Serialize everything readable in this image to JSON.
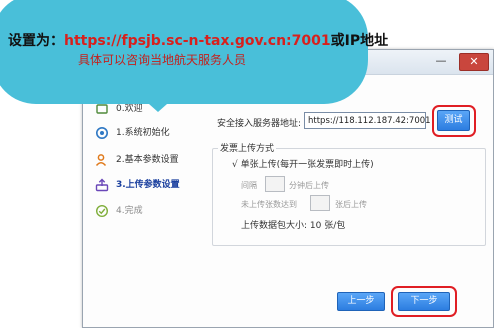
{
  "callout": {
    "prefix": "设置为：",
    "url": "https://fpsjb.sc-n-tax.gov.cn:7001",
    "suffix": "或IP地址",
    "line2": "具体可以咨询当地航天服务人员"
  },
  "window": {
    "minimize_glyph": "—",
    "close_glyph": "✕"
  },
  "steps": [
    {
      "label": "0.欢迎",
      "icon": "welcome-icon"
    },
    {
      "label": "1.系统初始化",
      "icon": "gear-icon"
    },
    {
      "label": "2.基本参数设置",
      "icon": "user-settings-icon"
    },
    {
      "label": "3.上传参数设置",
      "icon": "upload-icon"
    },
    {
      "label": "4.完成",
      "icon": "check-circle-icon"
    }
  ],
  "server": {
    "label": "安全接入服务器地址:",
    "value": "https://118.112.187.42:7001",
    "test_button": "测试"
  },
  "upload": {
    "group_title": "发票上传方式",
    "mode": "√ 单张上传(每开一张发票即时上传)",
    "interval_label": "间隔",
    "interval_suffix": "分钟后上传",
    "count_label": "未上传张数达到",
    "count_suffix": "张后上传",
    "packet_size": "上传数据包大小: 10 张/包"
  },
  "buttons": {
    "prev": "上一步",
    "next": "下一步"
  },
  "colors": {
    "bubble": "#49bfd9",
    "url_red": "#d8201c",
    "button_blue": "#2c7de0",
    "highlight_ring": "#e01e24",
    "active_step": "#1a3f9e"
  }
}
